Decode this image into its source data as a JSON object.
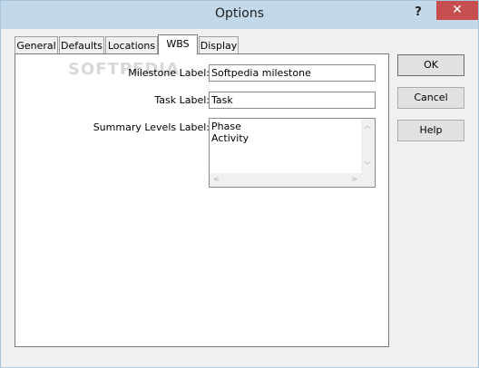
{
  "window": {
    "title": "Options",
    "help_glyph": "?",
    "close_glyph": "✕"
  },
  "tabs": [
    {
      "label": "General"
    },
    {
      "label": "Defaults"
    },
    {
      "label": "Locations"
    },
    {
      "label": "WBS"
    },
    {
      "label": "Display"
    }
  ],
  "active_tab": "WBS",
  "watermark": "SOFTPEDIA",
  "form": {
    "milestone_label": "Milestone Label:",
    "milestone_value": "Softpedia milestone",
    "task_label": "Task Label:",
    "task_value": "Task",
    "summary_label": "Summary Levels Label:",
    "summary_lines": [
      "Phase",
      "Activity"
    ]
  },
  "buttons": {
    "ok": "OK",
    "cancel": "Cancel",
    "help": "Help"
  },
  "colors": {
    "close_button": "#c74e4e",
    "titlebar": "#c3d8e8"
  }
}
